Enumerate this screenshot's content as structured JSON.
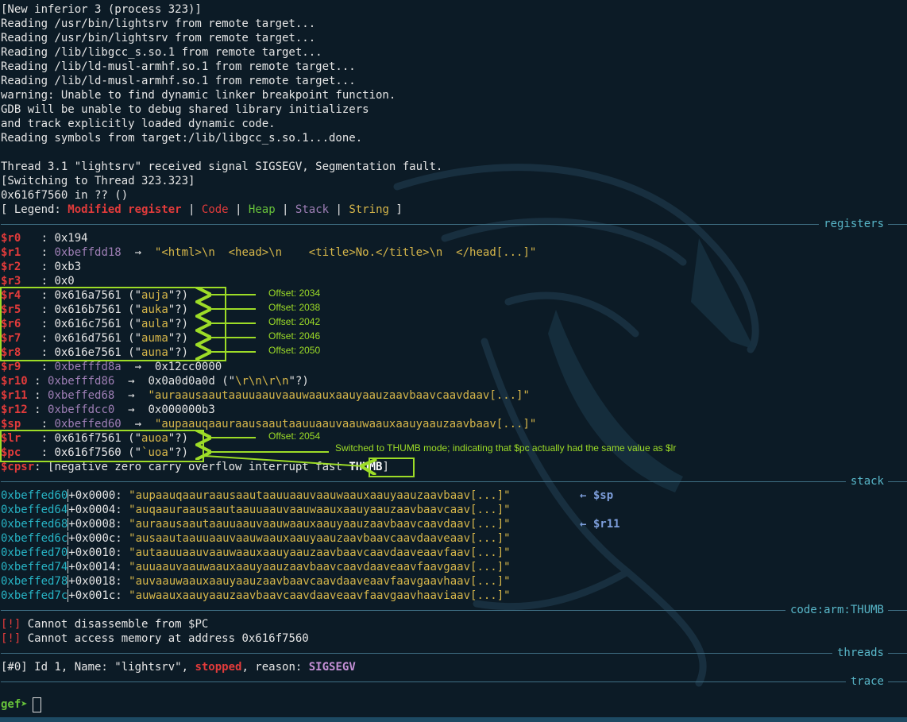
{
  "intro_lines": [
    "[New inferior 3 (process 323)]",
    "Reading /usr/bin/lightsrv from remote target...",
    "Reading /usr/bin/lightsrv from remote target...",
    "Reading /lib/libgcc_s.so.1 from remote target...",
    "Reading /lib/ld-musl-armhf.so.1 from remote target...",
    "Reading /lib/ld-musl-armhf.so.1 from remote target...",
    "warning: Unable to find dynamic linker breakpoint function.",
    "GDB will be unable to debug shared library initializers",
    "and track explicitly loaded dynamic code.",
    "Reading symbols from target:/lib/libgcc_s.so.1...done.",
    "",
    "Thread 3.1 \"lightsrv\" received signal SIGSEGV, Segmentation fault.",
    "[Switching to Thread 323.323]",
    "0x616f7560 in ?? ()"
  ],
  "legend": {
    "prefix": "[ Legend: ",
    "modified": "Modified register",
    "code": "Code",
    "heap": "Heap",
    "stack": "Stack",
    "string": "String",
    "suffix": " ]",
    "sep": " | "
  },
  "sections": {
    "registers": "registers",
    "stack": "stack",
    "code": "code:arm:THUMB",
    "threads": "threads",
    "trace": "trace"
  },
  "registers": {
    "r0": {
      "name": "$r0 ",
      "value": "0x194"
    },
    "r1": {
      "name": "$r1 ",
      "addr": "0xbeffdd18",
      "arrow": "  →  ",
      "str": "\"<html>\\n  <head>\\n    <title>No.</title>\\n  </head[...]\""
    },
    "r2": {
      "name": "$r2 ",
      "value": "0xb3"
    },
    "r3": {
      "name": "$r3 ",
      "value": "0x0"
    },
    "r4": {
      "name": "$r4 ",
      "value": "0x616a7561",
      "open": " (\"",
      "str": "auja",
      "close": "\"?)"
    },
    "r5": {
      "name": "$r5 ",
      "value": "0x616b7561",
      "open": " (\"",
      "str": "auka",
      "close": "\"?)"
    },
    "r6": {
      "name": "$r6 ",
      "value": "0x616c7561",
      "open": " (\"",
      "str": "aula",
      "close": "\"?)"
    },
    "r7": {
      "name": "$r7 ",
      "value": "0x616d7561",
      "open": " (\"",
      "str": "auma",
      "close": "\"?)"
    },
    "r8": {
      "name": "$r8 ",
      "value": "0x616e7561",
      "open": " (\"",
      "str": "auna",
      "close": "\"?)"
    },
    "r9": {
      "name": "$r9 ",
      "addr": "0xbefffd8a",
      "arrow": "  →  ",
      "value": "0x12cc0000"
    },
    "r10": {
      "name": "$r10",
      "addr": "0xbefffd86",
      "arrow": "  →  ",
      "value": "0x0a0d0a0d",
      "open": " (\"",
      "str": "\\r\\n\\r\\n",
      "close": "\"?)"
    },
    "r11": {
      "name": "$r11",
      "addr": "0xbeffed68",
      "arrow": "  →  ",
      "str": "\"auraausaautaauuaauvaauwaauxaauyaauzaavbaavcaavdaav[...]\""
    },
    "r12": {
      "name": "$r12",
      "addr": "0xbeffdcc0",
      "arrow": "  →  ",
      "value": "0x000000b3"
    },
    "sp": {
      "name": "$sp ",
      "addr": "0xbeffed60",
      "arrow": "  →  ",
      "str": "\"aupaauqaauraausaautaauuaauvaauwaauxaauyaauzaavbaav[...]\""
    },
    "lr": {
      "name": "$lr ",
      "value": "0x616f7561",
      "open": " (\"",
      "str": "auoa",
      "close": "\"?)"
    },
    "pc": {
      "name": "$pc ",
      "value": "0x616f7560",
      "open": " (\"",
      "str": "`uoa",
      "close": "\"?)"
    },
    "cpsr": {
      "name": "$cpsr",
      "flags": "[negative zero carry overflow interrupt fast ",
      "thumb": "THUMB",
      "end": "]"
    }
  },
  "colon": ": ",
  "stack_rows": [
    {
      "addr": "0xbeffed60",
      "off": "+0x0000: ",
      "str": "\"aupaauqaauraausaautaauuaauvaauwaauxaauyaauzaavbaav[...]\"",
      "tag": "← $sp"
    },
    {
      "addr": "0xbeffed64",
      "off": "+0x0004: ",
      "str": "\"auqaauraausaautaauuaauvaauwaauxaauyaauzaavbaavcaav[...]\"",
      "tag": ""
    },
    {
      "addr": "0xbeffed68",
      "off": "+0x0008: ",
      "str": "\"auraausaautaauuaauvaauwaauxaauyaauzaavbaavcaavdaav[...]\"",
      "tag": "← $r11"
    },
    {
      "addr": "0xbeffed6c",
      "off": "+0x000c: ",
      "str": "\"ausaautaauuaauvaauwaauxaauyaauzaavbaavcaavdaaveaav[...]\"",
      "tag": ""
    },
    {
      "addr": "0xbeffed70",
      "off": "+0x0010: ",
      "str": "\"autaauuaauvaauwaauxaauyaauzaavbaavcaavdaaveaavfaav[...]\"",
      "tag": ""
    },
    {
      "addr": "0xbeffed74",
      "off": "+0x0014: ",
      "str": "\"auuaauvaauwaauxaauyaauzaavbaavcaavdaaveaavfaavgaav[...]\"",
      "tag": ""
    },
    {
      "addr": "0xbeffed78",
      "off": "+0x0018: ",
      "str": "\"auvaauwaauxaauyaauzaavbaavcaavdaaveaavfaavgaavhaav[...]\"",
      "tag": ""
    },
    {
      "addr": "0xbeffed7c",
      "off": "+0x001c: ",
      "str": "\"auwaauxaauyaauzaavbaavcaavdaaveaavfaavgaavhaaviaav[...]\"",
      "tag": ""
    }
  ],
  "code_msgs": [
    {
      "tag": "[!]",
      "text": " Cannot disassemble from $PC"
    },
    {
      "tag": "[!]",
      "text": " Cannot access memory at address 0x616f7560"
    }
  ],
  "thread": {
    "id": "[#0]",
    "pre": " Id 1, Name: \"lightsrv\", ",
    "state": "stopped",
    "mid": ", reason: ",
    "reason": "SIGSEGV"
  },
  "prompt": "gef➤",
  "annotations": {
    "off_r4": "Offset: 2034",
    "off_r5": "Offset: 2038",
    "off_r6": "Offset: 2042",
    "off_r7": "Offset: 2046",
    "off_r8": "Offset: 2050",
    "off_lr": "Offset: 2054",
    "thumb_note": "Switched to THUMB mode; indicating that $pc actually had the same value as $lr"
  },
  "colors": {
    "background": "#0c1b26",
    "modified_register": "#e23b3b",
    "code": "#e23b3b",
    "heap": "#67c23a",
    "stack": "#9f7fb6",
    "string": "#d6b64a",
    "address": "#27b3c4",
    "annotation": "#9ddc27",
    "section_title": "#58b6c8"
  }
}
